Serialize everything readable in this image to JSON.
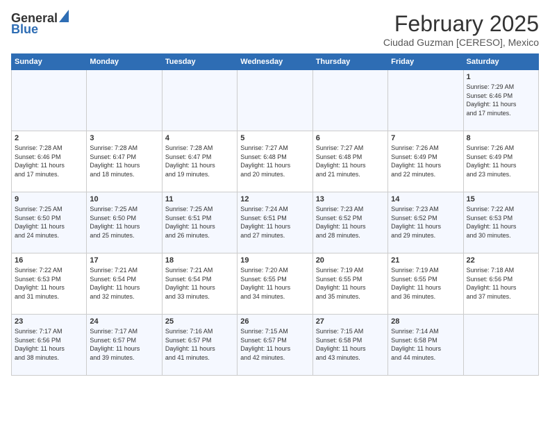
{
  "logo": {
    "general": "General",
    "blue": "Blue"
  },
  "title": "February 2025",
  "location": "Ciudad Guzman [CERESO], Mexico",
  "days_of_week": [
    "Sunday",
    "Monday",
    "Tuesday",
    "Wednesday",
    "Thursday",
    "Friday",
    "Saturday"
  ],
  "weeks": [
    [
      {
        "day": "",
        "info": ""
      },
      {
        "day": "",
        "info": ""
      },
      {
        "day": "",
        "info": ""
      },
      {
        "day": "",
        "info": ""
      },
      {
        "day": "",
        "info": ""
      },
      {
        "day": "",
        "info": ""
      },
      {
        "day": "1",
        "info": "Sunrise: 7:29 AM\nSunset: 6:46 PM\nDaylight: 11 hours\nand 17 minutes."
      }
    ],
    [
      {
        "day": "2",
        "info": "Sunrise: 7:28 AM\nSunset: 6:46 PM\nDaylight: 11 hours\nand 17 minutes."
      },
      {
        "day": "3",
        "info": "Sunrise: 7:28 AM\nSunset: 6:47 PM\nDaylight: 11 hours\nand 18 minutes."
      },
      {
        "day": "4",
        "info": "Sunrise: 7:28 AM\nSunset: 6:47 PM\nDaylight: 11 hours\nand 19 minutes."
      },
      {
        "day": "5",
        "info": "Sunrise: 7:27 AM\nSunset: 6:48 PM\nDaylight: 11 hours\nand 20 minutes."
      },
      {
        "day": "6",
        "info": "Sunrise: 7:27 AM\nSunset: 6:48 PM\nDaylight: 11 hours\nand 21 minutes."
      },
      {
        "day": "7",
        "info": "Sunrise: 7:26 AM\nSunset: 6:49 PM\nDaylight: 11 hours\nand 22 minutes."
      },
      {
        "day": "8",
        "info": "Sunrise: 7:26 AM\nSunset: 6:49 PM\nDaylight: 11 hours\nand 23 minutes."
      }
    ],
    [
      {
        "day": "9",
        "info": "Sunrise: 7:25 AM\nSunset: 6:50 PM\nDaylight: 11 hours\nand 24 minutes."
      },
      {
        "day": "10",
        "info": "Sunrise: 7:25 AM\nSunset: 6:50 PM\nDaylight: 11 hours\nand 25 minutes."
      },
      {
        "day": "11",
        "info": "Sunrise: 7:25 AM\nSunset: 6:51 PM\nDaylight: 11 hours\nand 26 minutes."
      },
      {
        "day": "12",
        "info": "Sunrise: 7:24 AM\nSunset: 6:51 PM\nDaylight: 11 hours\nand 27 minutes."
      },
      {
        "day": "13",
        "info": "Sunrise: 7:23 AM\nSunset: 6:52 PM\nDaylight: 11 hours\nand 28 minutes."
      },
      {
        "day": "14",
        "info": "Sunrise: 7:23 AM\nSunset: 6:52 PM\nDaylight: 11 hours\nand 29 minutes."
      },
      {
        "day": "15",
        "info": "Sunrise: 7:22 AM\nSunset: 6:53 PM\nDaylight: 11 hours\nand 30 minutes."
      }
    ],
    [
      {
        "day": "16",
        "info": "Sunrise: 7:22 AM\nSunset: 6:53 PM\nDaylight: 11 hours\nand 31 minutes."
      },
      {
        "day": "17",
        "info": "Sunrise: 7:21 AM\nSunset: 6:54 PM\nDaylight: 11 hours\nand 32 minutes."
      },
      {
        "day": "18",
        "info": "Sunrise: 7:21 AM\nSunset: 6:54 PM\nDaylight: 11 hours\nand 33 minutes."
      },
      {
        "day": "19",
        "info": "Sunrise: 7:20 AM\nSunset: 6:55 PM\nDaylight: 11 hours\nand 34 minutes."
      },
      {
        "day": "20",
        "info": "Sunrise: 7:19 AM\nSunset: 6:55 PM\nDaylight: 11 hours\nand 35 minutes."
      },
      {
        "day": "21",
        "info": "Sunrise: 7:19 AM\nSunset: 6:55 PM\nDaylight: 11 hours\nand 36 minutes."
      },
      {
        "day": "22",
        "info": "Sunrise: 7:18 AM\nSunset: 6:56 PM\nDaylight: 11 hours\nand 37 minutes."
      }
    ],
    [
      {
        "day": "23",
        "info": "Sunrise: 7:17 AM\nSunset: 6:56 PM\nDaylight: 11 hours\nand 38 minutes."
      },
      {
        "day": "24",
        "info": "Sunrise: 7:17 AM\nSunset: 6:57 PM\nDaylight: 11 hours\nand 39 minutes."
      },
      {
        "day": "25",
        "info": "Sunrise: 7:16 AM\nSunset: 6:57 PM\nDaylight: 11 hours\nand 41 minutes."
      },
      {
        "day": "26",
        "info": "Sunrise: 7:15 AM\nSunset: 6:57 PM\nDaylight: 11 hours\nand 42 minutes."
      },
      {
        "day": "27",
        "info": "Sunrise: 7:15 AM\nSunset: 6:58 PM\nDaylight: 11 hours\nand 43 minutes."
      },
      {
        "day": "28",
        "info": "Sunrise: 7:14 AM\nSunset: 6:58 PM\nDaylight: 11 hours\nand 44 minutes."
      },
      {
        "day": "",
        "info": ""
      }
    ]
  ]
}
